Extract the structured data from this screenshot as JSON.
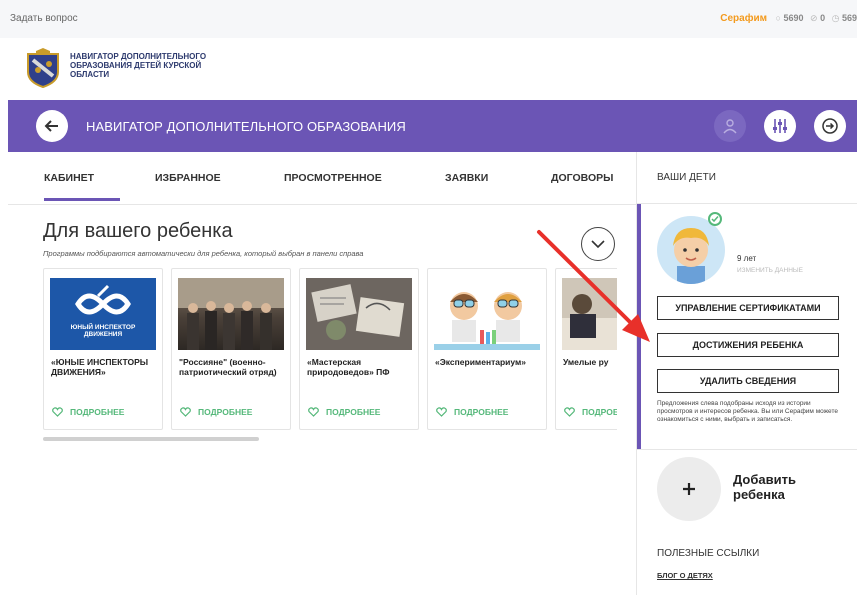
{
  "topbar": {
    "ask_question": "Задать вопрос",
    "user_name": "Серафим",
    "stat_1": "5690",
    "stat_2": "0",
    "stat_3": "569"
  },
  "logo": {
    "text": "Навигатор дополнительного образования детей Курской области"
  },
  "navbar": {
    "title": "Навигатор дополнительного образования"
  },
  "tabs": [
    {
      "label": "Кабинет",
      "active": true
    },
    {
      "label": "Избранное"
    },
    {
      "label": "Просмотренное"
    },
    {
      "label": "Заявки"
    },
    {
      "label": "Договоры"
    }
  ],
  "main": {
    "title": "Для вашего ребенка",
    "subtitle": "Программы подбираются автоматически для ребенка, который выбран в панели справа",
    "more_label": "Подробнее",
    "cards": [
      {
        "title": "«Юные инспекторы движения»",
        "image_text": "ЮНЫЙ ИНСПЕКТОР ДВИЖЕНИЯ"
      },
      {
        "title": "\"Россияне\" (военно-патриотический отряд)"
      },
      {
        "title": "«Мастерская природоведов» ПФ"
      },
      {
        "title": "«Экспериментариум»"
      },
      {
        "title": "Умелые ру"
      }
    ]
  },
  "right_panel": {
    "header": "Ваши дети",
    "child": {
      "age": "9 лет",
      "edit_label": "Изменить данные"
    },
    "buttons": [
      "Управление сертификатами",
      "Достижения ребенка",
      "Удалить сведения"
    ],
    "note": "Предложения слева подобраны исходя из истории просмотров и интересов ребенка. Вы или Серафим можете ознакомиться с ними, выбрать и записаться.",
    "add_child": "Добавить ребенка",
    "useful_links_title": "Полезные ссылки",
    "blog_link": "Блог о детях"
  },
  "colors": {
    "brand_purple": "#6b55b5",
    "accent_green": "#55b87a",
    "accent_orange": "#f39a1d",
    "annotation_red": "#e8302a"
  }
}
